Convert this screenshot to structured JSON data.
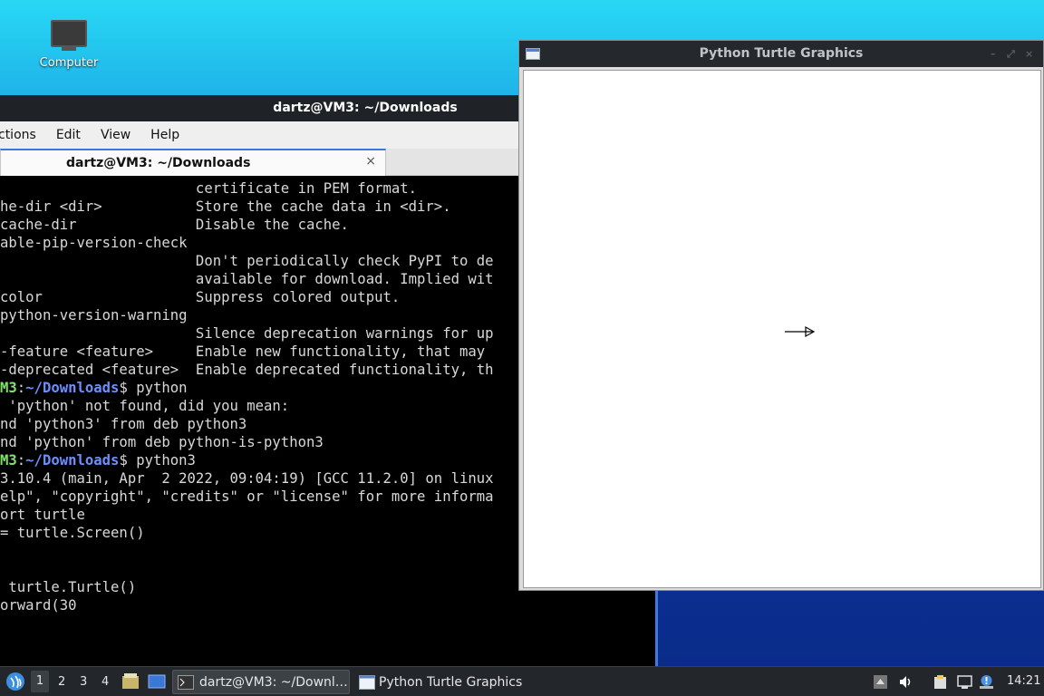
{
  "desktop": {
    "icon_label": "Computer"
  },
  "terminal": {
    "title": "dartz@VM3: ~/Downloads",
    "menu": [
      "ctions",
      "Edit",
      "View",
      "Help"
    ],
    "tab_label": "dartz@VM3: ~/Downloads",
    "tab_close": "×",
    "lines": [
      {
        "t": "                       certificate in PEM format."
      },
      {
        "t": "he-dir <dir>           Store the cache data in <dir>."
      },
      {
        "t": "cache-dir              Disable the cache."
      },
      {
        "t": "able-pip-version-check"
      },
      {
        "t": "                       Don't periodically check PyPI to de"
      },
      {
        "t": "                       available for download. Implied wit"
      },
      {
        "t": "color                  Suppress colored output."
      },
      {
        "t": "python-version-warning"
      },
      {
        "t": "                       Silence deprecation warnings for up"
      },
      {
        "t": "-feature <feature>     Enable new functionality, that may"
      },
      {
        "t": "-deprecated <feature>  Enable deprecated functionality, th"
      },
      {
        "p1": "M3",
        "p2": ":",
        "p3": "~/Downloads",
        "p4": "$ python"
      },
      {
        "t": " 'python' not found, did you mean:"
      },
      {
        "t": "nd 'python3' from deb python3"
      },
      {
        "t": "nd 'python' from deb python-is-python3"
      },
      {
        "p1": "M3",
        "p2": ":",
        "p3": "~/Downloads",
        "p4": "$ python3"
      },
      {
        "t": "3.10.4 (main, Apr  2 2022, 09:04:19) [GCC 11.2.0] on linux"
      },
      {
        "t": "elp\", \"copyright\", \"credits\" or \"license\" for more informa"
      },
      {
        "t": "ort turtle"
      },
      {
        "t": "= turtle.Screen()"
      },
      {
        "t": ""
      },
      {
        "t": ""
      },
      {
        "t": " turtle.Turtle()"
      },
      {
        "t": "orward(30"
      }
    ]
  },
  "turtle_window": {
    "title": "Python Turtle Graphics",
    "controls": [
      "–",
      "⤢",
      "×"
    ]
  },
  "taskbar": {
    "workspaces": [
      "1",
      "2",
      "3",
      "4"
    ],
    "tasks": [
      "dartz@VM3: ~/Downl…",
      "Python Turtle Graphics"
    ],
    "clock": "14:21"
  }
}
